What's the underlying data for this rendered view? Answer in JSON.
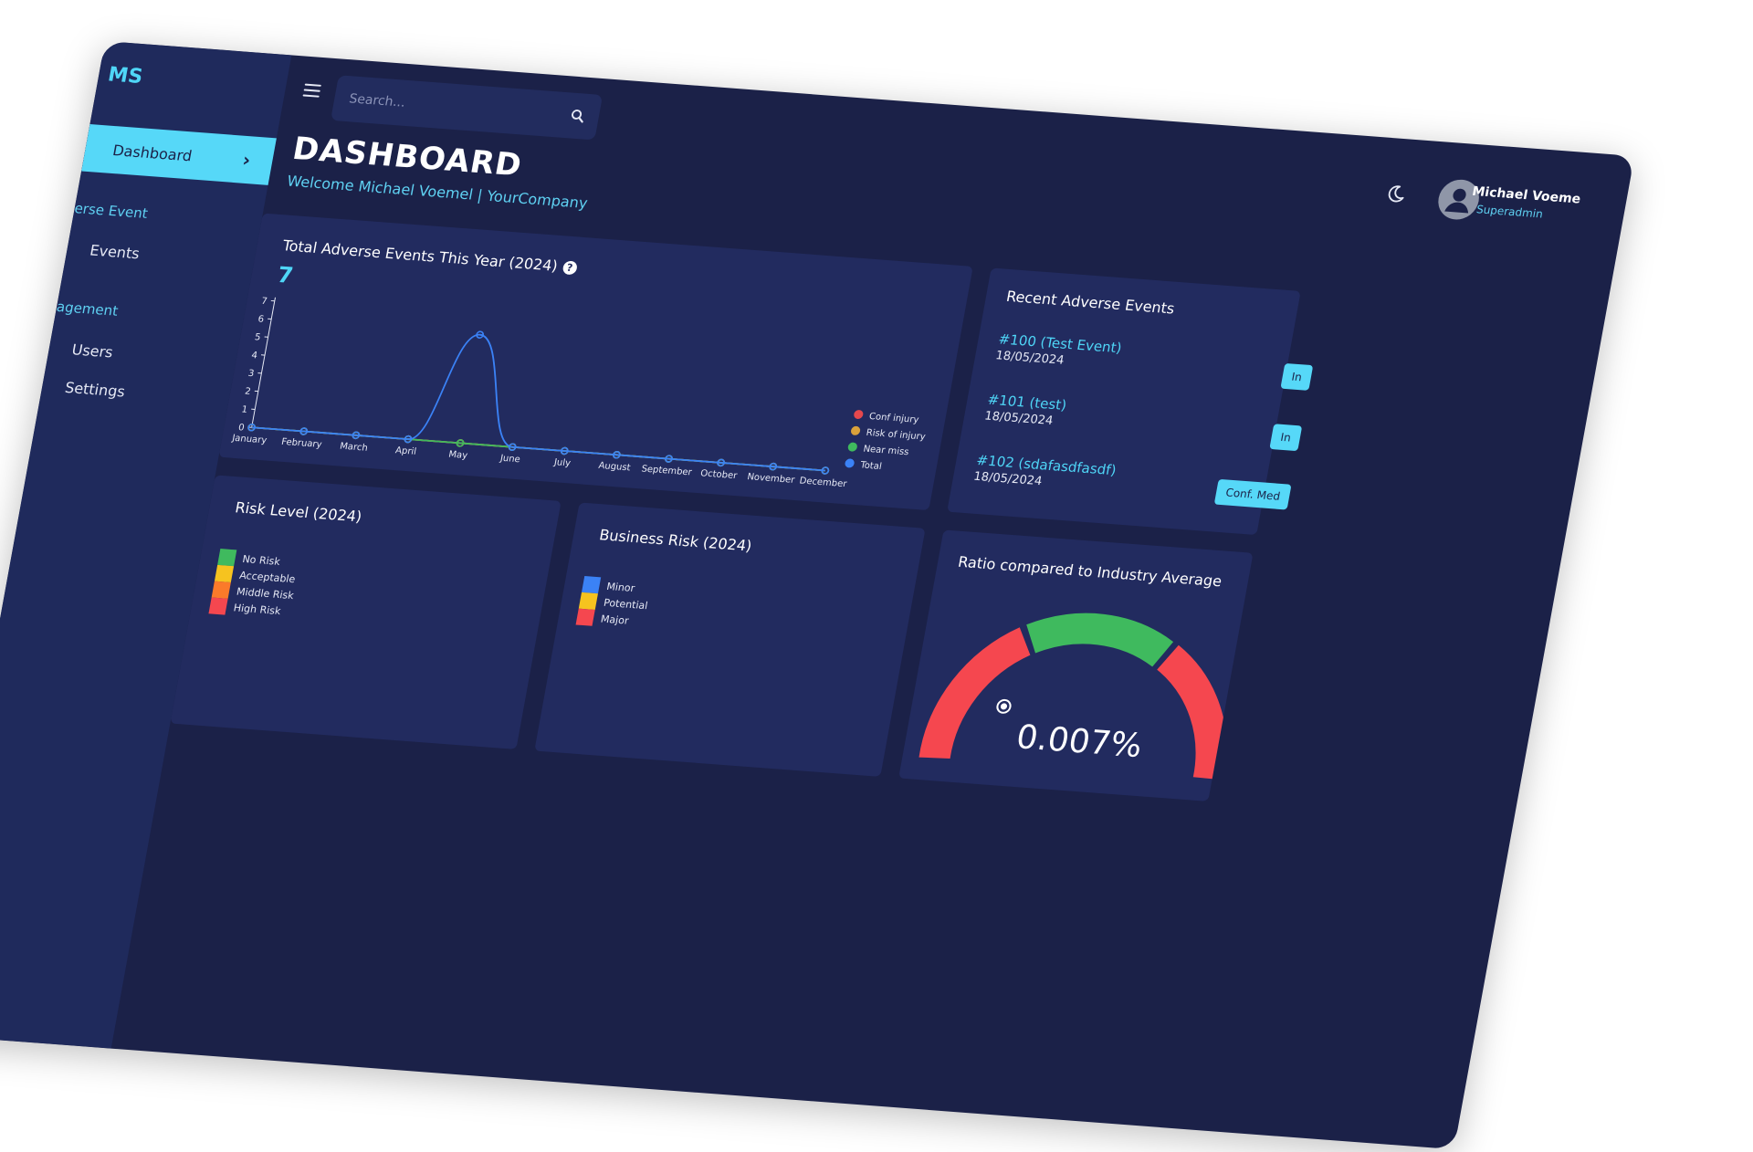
{
  "sidebar": {
    "brand": "MS",
    "active_item": "Dashboard",
    "section_adverse": "erse Event",
    "item_events": "Events",
    "section_management": "agement",
    "item_users": "Users",
    "item_settings": "Settings"
  },
  "topbar": {
    "search_placeholder": "Search...",
    "user_name": "Michael Voeme",
    "user_role": "Superadmin"
  },
  "header": {
    "title": "DASHBOARD",
    "welcome": "Welcome Michael Voemel | YourCompany"
  },
  "adverse_chart": {
    "title": "Total Adverse Events This Year (2024)",
    "total": "7"
  },
  "chart_data": {
    "type": "line",
    "categories": [
      "January",
      "February",
      "March",
      "April",
      "May",
      "June",
      "July",
      "August",
      "September",
      "October",
      "November",
      "December"
    ],
    "y_ticks": [
      "0",
      "1",
      "2",
      "3",
      "4",
      "5",
      "6",
      "7"
    ],
    "ylim": [
      0,
      7
    ],
    "series": [
      {
        "name": "Conf injury",
        "color": "#e5484d",
        "values": [
          0,
          0,
          0,
          0,
          0,
          0,
          0,
          0,
          0,
          0,
          0,
          0
        ]
      },
      {
        "name": "Risk of injury",
        "color": "#d9a13b",
        "values": [
          0,
          0,
          0,
          0,
          0,
          0,
          0,
          0,
          0,
          0,
          0,
          0
        ]
      },
      {
        "name": "Near miss",
        "color": "#3fba5e",
        "values": [
          0,
          0,
          0,
          0,
          0,
          0,
          0,
          0,
          0,
          0,
          0,
          0
        ]
      },
      {
        "name": "Total",
        "color": "#3b82f6",
        "values": [
          0,
          0,
          0,
          0,
          6,
          0,
          0,
          0,
          0,
          0,
          0,
          0
        ]
      }
    ],
    "legend_position": "right"
  },
  "recent_events": {
    "title": "Recent Adverse Events",
    "items": [
      {
        "id": "#100 (Test Event)",
        "date": "18/05/2024",
        "badge": "In"
      },
      {
        "id": "#101 (test)",
        "date": "18/05/2024",
        "badge": "In"
      },
      {
        "id": "#102 (sdafasdfasdf)",
        "date": "18/05/2024",
        "badge": "Conf. Med"
      }
    ]
  },
  "risk_level": {
    "title": "Risk Level (2024)",
    "legend": [
      {
        "label": "No Risk",
        "color": "#3fba5e"
      },
      {
        "label": "Acceptable",
        "color": "#f6c31f"
      },
      {
        "label": "Middle Risk",
        "color": "#fb7a2a"
      },
      {
        "label": "High Risk",
        "color": "#f5474f"
      }
    ]
  },
  "business_risk": {
    "title": "Business Risk (2024)",
    "legend": [
      {
        "label": "Minor",
        "color": "#3b82f6"
      },
      {
        "label": "Potential",
        "color": "#f6c31f"
      },
      {
        "label": "Major",
        "color": "#f5474f"
      }
    ]
  },
  "ratio": {
    "title": "Ratio compared to Industry Average",
    "value": "0.007%",
    "gauge_colors": [
      "#f5474f",
      "#3fba5e",
      "#f5474f"
    ],
    "gauge_level": 7e-05
  }
}
